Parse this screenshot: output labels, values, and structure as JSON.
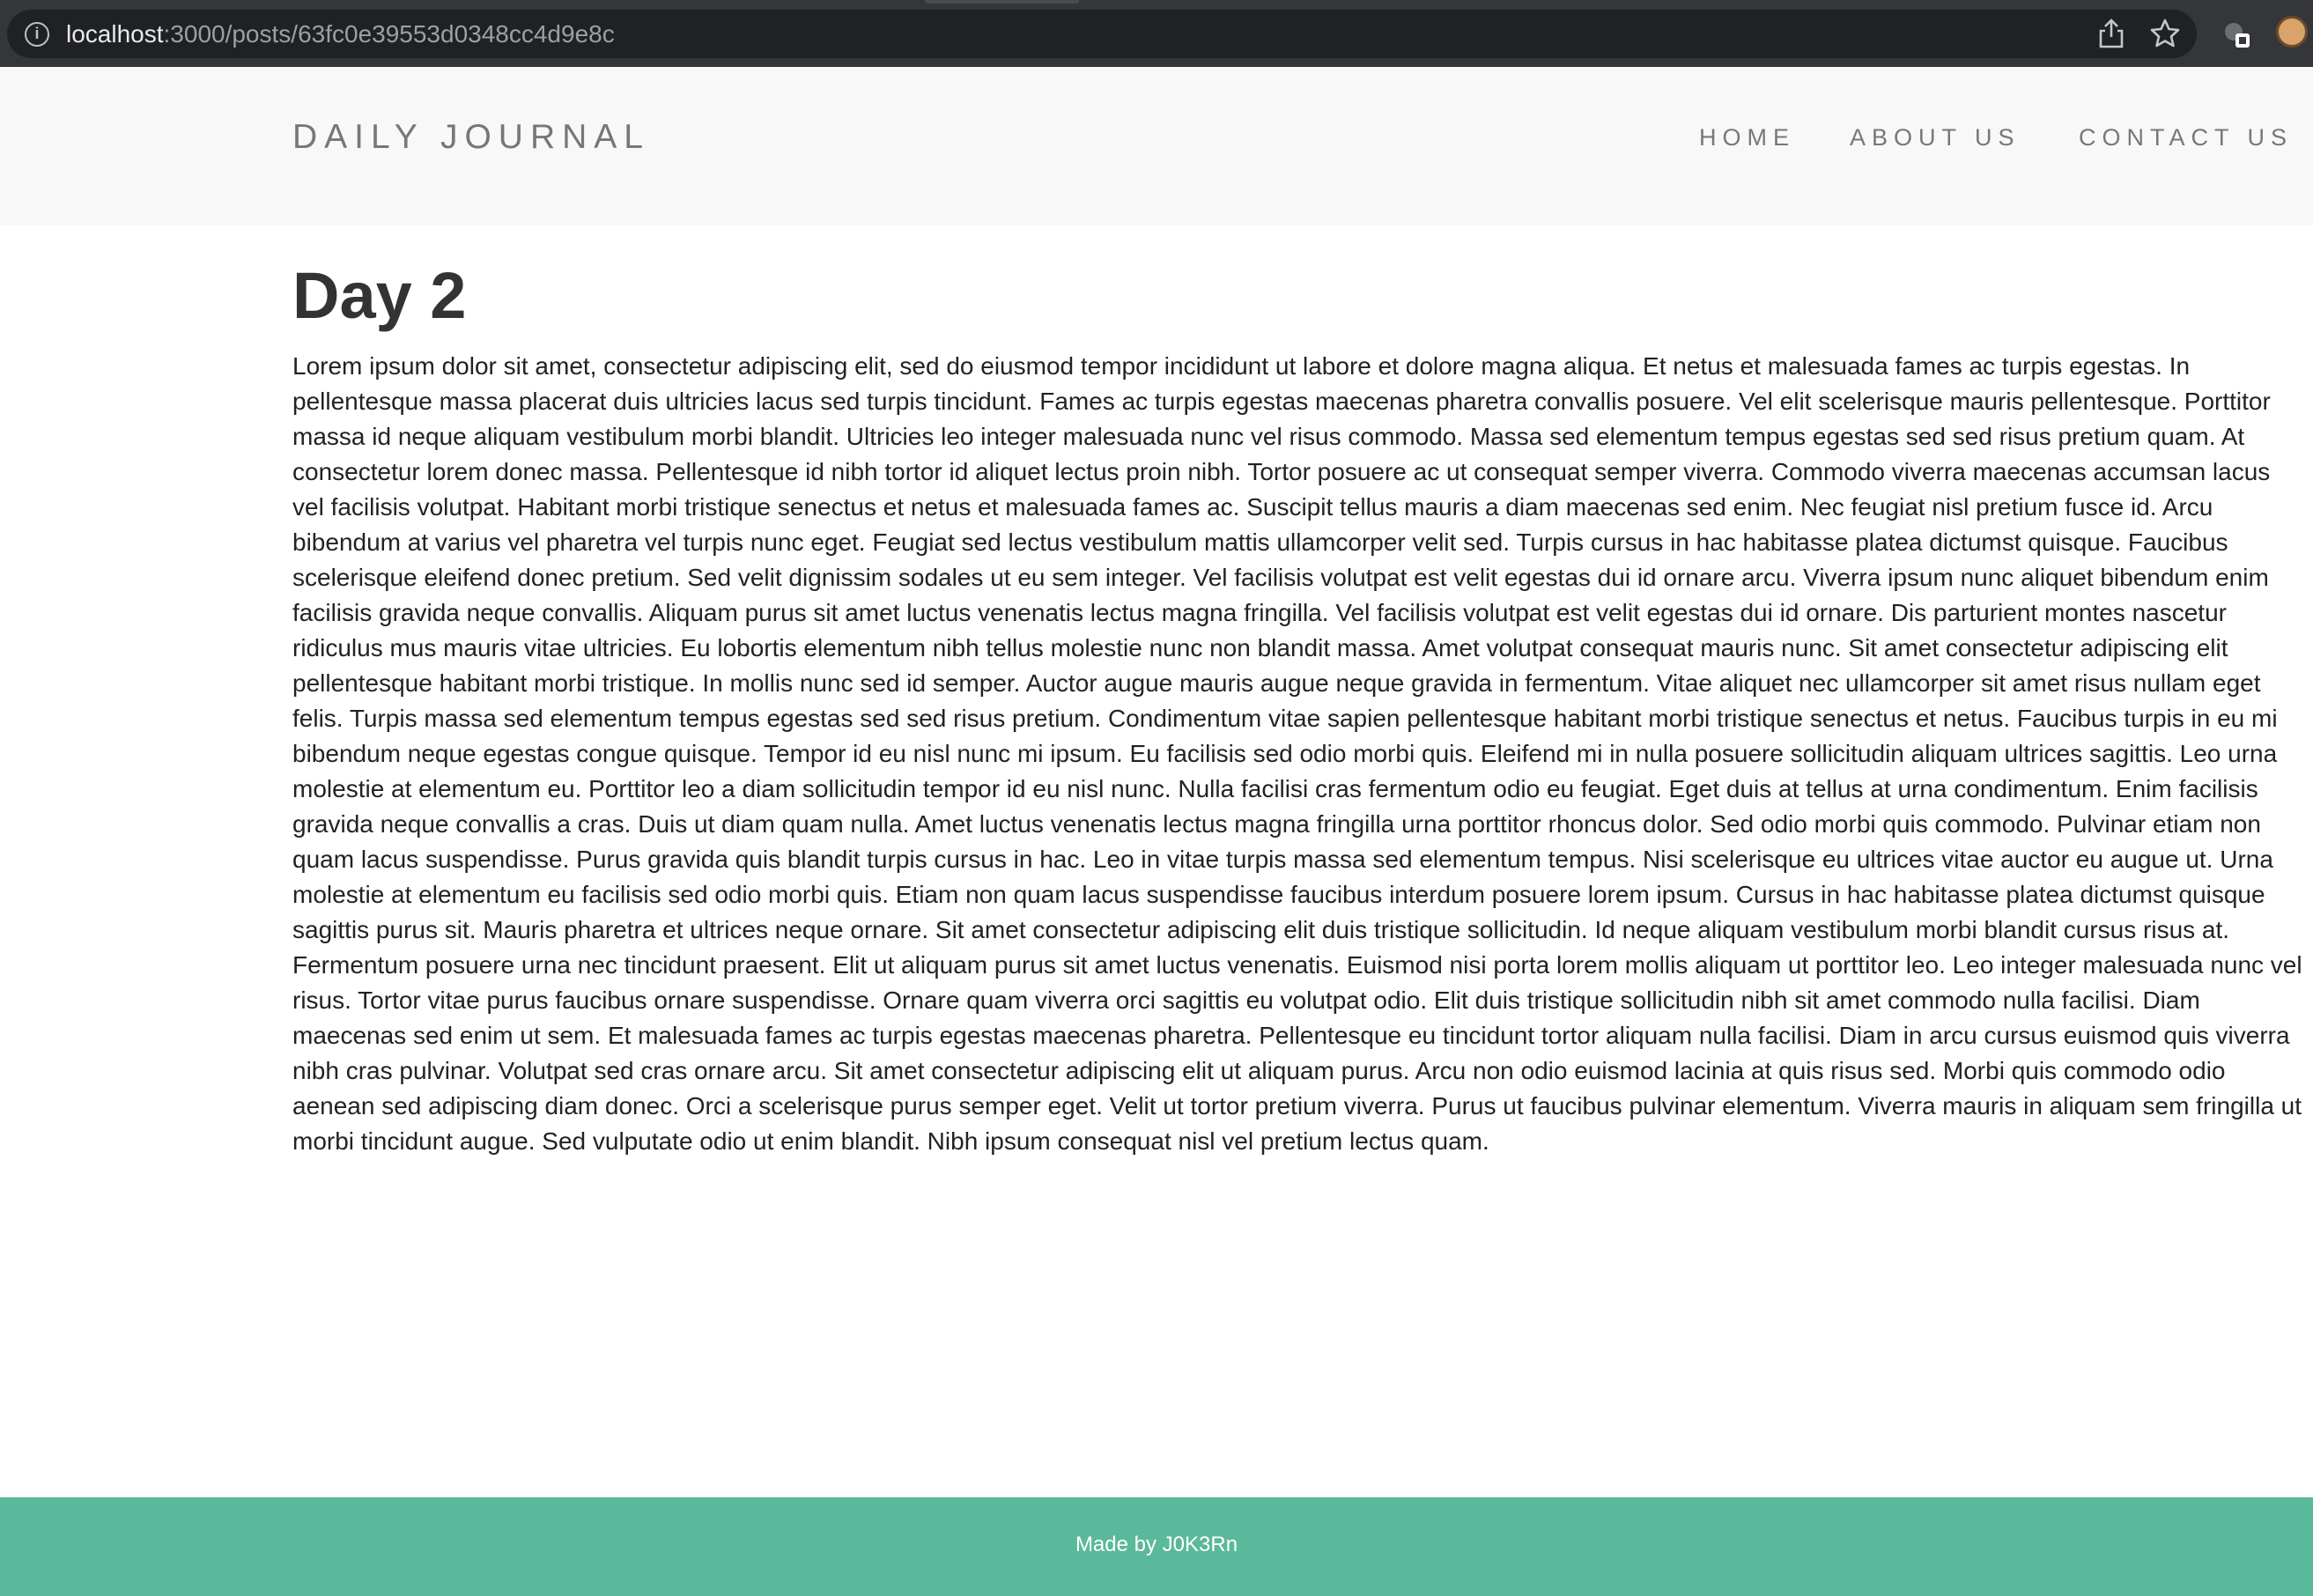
{
  "browser": {
    "url_host": "localhost",
    "url_path": ":3000/posts/63fc0e39553d0348cc4d9e8c"
  },
  "header": {
    "brand": "DAILY JOURNAL",
    "nav": {
      "home": "HOME",
      "about": "ABOUT US",
      "contact": "CONTACT US"
    }
  },
  "post": {
    "title": "Day 2",
    "body": "Lorem ipsum dolor sit amet, consectetur adipiscing elit, sed do eiusmod tempor incididunt ut labore et dolore magna aliqua. Et netus et malesuada fames ac turpis egestas. In pellentesque massa placerat duis ultricies lacus sed turpis tincidunt. Fames ac turpis egestas maecenas pharetra convallis posuere. Vel elit scelerisque mauris pellentesque. Porttitor massa id neque aliquam vestibulum morbi blandit. Ultricies leo integer malesuada nunc vel risus commodo. Massa sed elementum tempus egestas sed sed risus pretium quam. At consectetur lorem donec massa. Pellentesque id nibh tortor id aliquet lectus proin nibh. Tortor posuere ac ut consequat semper viverra. Commodo viverra maecenas accumsan lacus vel facilisis volutpat. Habitant morbi tristique senectus et netus et malesuada fames ac. Suscipit tellus mauris a diam maecenas sed enim. Nec feugiat nisl pretium fusce id. Arcu bibendum at varius vel pharetra vel turpis nunc eget. Feugiat sed lectus vestibulum mattis ullamcorper velit sed. Turpis cursus in hac habitasse platea dictumst quisque. Faucibus scelerisque eleifend donec pretium. Sed velit dignissim sodales ut eu sem integer. Vel facilisis volutpat est velit egestas dui id ornare arcu. Viverra ipsum nunc aliquet bibendum enim facilisis gravida neque convallis. Aliquam purus sit amet luctus venenatis lectus magna fringilla. Vel facilisis volutpat est velit egestas dui id ornare. Dis parturient montes nascetur ridiculus mus mauris vitae ultricies. Eu lobortis elementum nibh tellus molestie nunc non blandit massa. Amet volutpat consequat mauris nunc. Sit amet consectetur adipiscing elit pellentesque habitant morbi tristique. In mollis nunc sed id semper. Auctor augue mauris augue neque gravida in fermentum. Vitae aliquet nec ullamcorper sit amet risus nullam eget felis. Turpis massa sed elementum tempus egestas sed sed risus pretium. Condimentum vitae sapien pellentesque habitant morbi tristique senectus et netus. Faucibus turpis in eu mi bibendum neque egestas congue quisque. Tempor id eu nisl nunc mi ipsum. Eu facilisis sed odio morbi quis. Eleifend mi in nulla posuere sollicitudin aliquam ultrices sagittis. Leo urna molestie at elementum eu. Porttitor leo a diam sollicitudin tempor id eu nisl nunc. Nulla facilisi cras fermentum odio eu feugiat. Eget duis at tellus at urna condimentum. Enim facilisis gravida neque convallis a cras. Duis ut diam quam nulla. Amet luctus venenatis lectus magna fringilla urna porttitor rhoncus dolor. Sed odio morbi quis commodo. Pulvinar etiam non quam lacus suspendisse. Purus gravida quis blandit turpis cursus in hac. Leo in vitae turpis massa sed elementum tempus. Nisi scelerisque eu ultrices vitae auctor eu augue ut. Urna molestie at elementum eu facilisis sed odio morbi quis. Etiam non quam lacus suspendisse faucibus interdum posuere lorem ipsum. Cursus in hac habitasse platea dictumst quisque sagittis purus sit. Mauris pharetra et ultrices neque ornare. Sit amet consectetur adipiscing elit duis tristique sollicitudin. Id neque aliquam vestibulum morbi blandit cursus risus at. Fermentum posuere urna nec tincidunt praesent. Elit ut aliquam purus sit amet luctus venenatis. Euismod nisi porta lorem mollis aliquam ut porttitor leo. Leo integer malesuada nunc vel risus. Tortor vitae purus faucibus ornare suspendisse. Ornare quam viverra orci sagittis eu volutpat odio. Elit duis tristique sollicitudin nibh sit amet commodo nulla facilisi. Diam maecenas sed enim ut sem. Et malesuada fames ac turpis egestas maecenas pharetra. Pellentesque eu tincidunt tortor aliquam nulla facilisi. Diam in arcu cursus euismod quis viverra nibh cras pulvinar. Volutpat sed cras ornare arcu. Sit amet consectetur adipiscing elit ut aliquam purus. Arcu non odio euismod lacinia at quis risus sed. Morbi quis commodo odio aenean sed adipiscing diam donec. Orci a scelerisque purus semper eget. Velit ut tortor pretium viverra. Purus ut faucibus pulvinar elementum. Viverra mauris in aliquam sem fringilla ut morbi tincidunt augue. Sed vulputate odio ut enim blandit. Nibh ipsum consequat nisl vel pretium lectus quam."
  },
  "footer": {
    "text": "Made by J0K3Rn"
  },
  "colors": {
    "footer_bg": "#5ab99a",
    "header_bg": "#f8f8f8",
    "browser_bg": "#35363a"
  }
}
